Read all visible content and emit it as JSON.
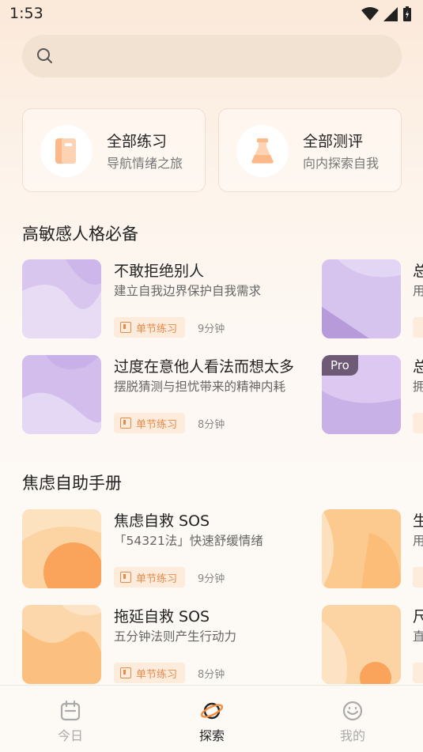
{
  "status": {
    "time": "1:53"
  },
  "search": {
    "placeholder": ""
  },
  "categories": [
    {
      "title": "全部练习",
      "subtitle": "导航情绪之旅",
      "icon": "book-icon"
    },
    {
      "title": "全部测评",
      "subtitle": "向内探索自我",
      "icon": "flask-icon"
    }
  ],
  "sections": [
    {
      "title": "高敏感人格必备",
      "items": [
        {
          "title": "不敢拒绝别人",
          "desc": "建立自我边界保护自我需求",
          "tag": "单节练习",
          "duration": "9分钟"
        },
        {
          "title": "过度在意他人看法而想太多",
          "desc": "摆脱猜测与担忧带来的精神内耗",
          "tag": "单节练习",
          "duration": "8分钟"
        }
      ],
      "side": [
        {
          "title": "总",
          "desc": "用"
        },
        {
          "title": "总",
          "desc": "拥",
          "badge": "Pro"
        }
      ]
    },
    {
      "title": "焦虑自助手册",
      "items": [
        {
          "title": "焦虑自救 SOS",
          "desc": "「54321法」快速舒缓情绪",
          "tag": "单节练习",
          "duration": "9分钟"
        },
        {
          "title": "拖延自救 SOS",
          "desc": "五分钟法则产生行动力",
          "tag": "单节练习",
          "duration": "8分钟"
        }
      ],
      "side": [
        {
          "title": "生",
          "desc": "用"
        },
        {
          "title": "尺",
          "desc": "直"
        }
      ]
    }
  ],
  "nav": [
    {
      "label": "今日",
      "icon": "calendar-icon",
      "active": false
    },
    {
      "label": "探索",
      "icon": "planet-icon",
      "active": true
    },
    {
      "label": "我的",
      "icon": "smiley-icon",
      "active": false
    }
  ],
  "colors": {
    "accent": "#e58b4c",
    "purple": "#c9b3e6",
    "orange": "#fbc88e"
  }
}
